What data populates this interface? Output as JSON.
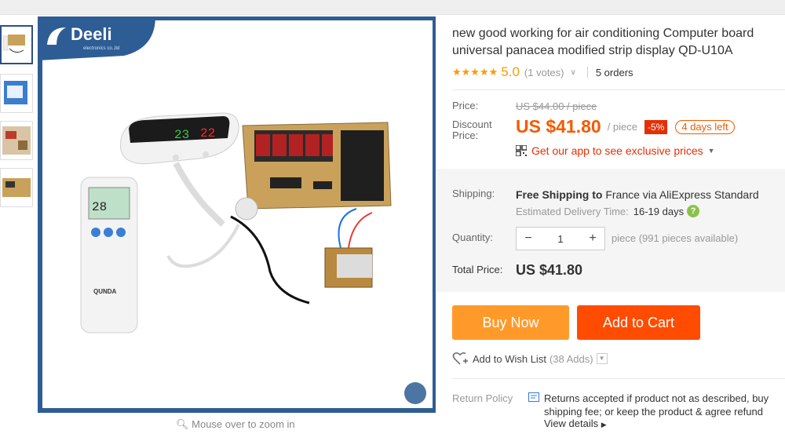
{
  "gallery": {
    "zoom_hint": "Mouse over to zoom in",
    "brand_name": "Deeli",
    "brand_sub": "electronics co.,ltd",
    "display_left": "23",
    "display_right": "22",
    "remote_display": "28",
    "remote_brand": "QUNDA"
  },
  "product": {
    "title_line1": "new good working for air conditioning Computer board",
    "title_line2": "universal panacea modified strip display QD-U10A",
    "stars": "★★★★★",
    "rating": "5.0",
    "votes": "(1 votes)",
    "orders": "5 orders"
  },
  "pricing": {
    "price_label": "Price:",
    "old_price": "US $44.00 / piece",
    "discount_label_1": "Discount",
    "discount_label_2": "Price:",
    "price": "US $41.80",
    "per_piece": "/ piece",
    "discount_pct": "-5%",
    "days_left": "4 days left",
    "app_offer": "Get our app to see exclusive prices"
  },
  "shipping": {
    "label": "Shipping:",
    "free": "Free Shipping to",
    "destination": "France via AliExpress Standard",
    "delivery_label": "Estimated Delivery Time:",
    "delivery_days": "16-19 days"
  },
  "quantity": {
    "label": "Quantity:",
    "value": "1",
    "minus": "−",
    "plus": "+",
    "note": "piece (991 pieces available)"
  },
  "total": {
    "label": "Total Price:",
    "value": "US $41.80"
  },
  "actions": {
    "buy_now": "Buy Now",
    "add_to_cart": "Add to Cart",
    "wish_list": "Add to Wish List",
    "wish_count": "(38 Adds)"
  },
  "return_policy": {
    "label": "Return Policy",
    "line1": "Returns accepted if product not as described, buy",
    "line2": "shipping fee; or keep the product & agree refund",
    "view_details": "View details"
  },
  "colors": {
    "price": "#f45a00",
    "buy_now": "#ff9a2a",
    "add_to_cart": "#ff4c00",
    "frame_blue": "#2d5d94",
    "star": "#ff9900"
  }
}
